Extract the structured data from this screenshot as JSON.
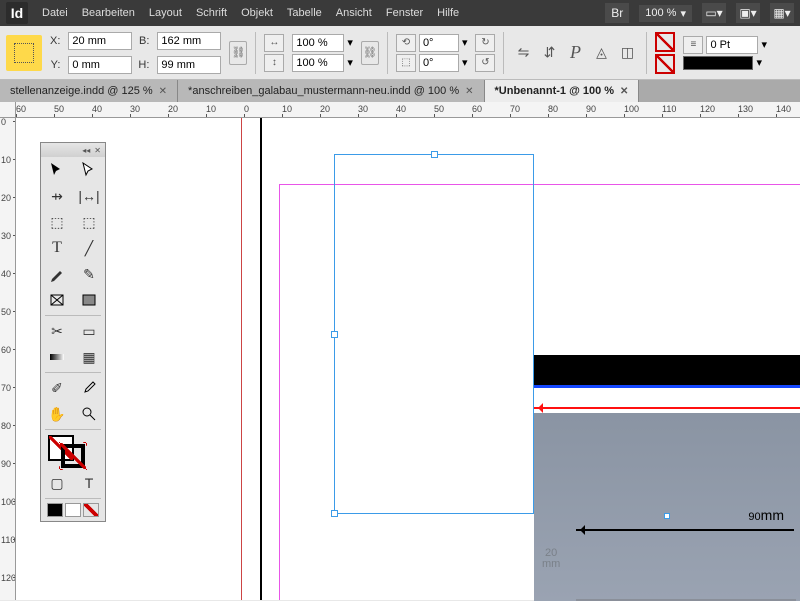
{
  "app": {
    "logo": "Id"
  },
  "menu": [
    "Datei",
    "Bearbeiten",
    "Layout",
    "Schrift",
    "Objekt",
    "Tabelle",
    "Ansicht",
    "Fenster",
    "Hilfe"
  ],
  "appbar": {
    "bridge_label": "Br",
    "zoom": "100 %"
  },
  "control": {
    "x_label": "X:",
    "x_val": "20 mm",
    "y_label": "Y:",
    "y_val": "0 mm",
    "w_label": "B:",
    "w_val": "162 mm",
    "h_label": "H:",
    "h_val": "99 mm",
    "scale_x": "100 %",
    "scale_y": "100 %",
    "rotate": "0°",
    "shear": "0°",
    "stroke_pt": "0 Pt"
  },
  "tabs": [
    {
      "label": "stellenanzeige.indd @ 125 %",
      "active": false
    },
    {
      "label": "*anschreiben_galabau_mustermann-neu.indd @ 100 %",
      "active": false
    },
    {
      "label": "*Unbenannt-1 @ 100 %",
      "active": true
    }
  ],
  "ruler_h": [
    "60",
    "50",
    "40",
    "30",
    "20",
    "10",
    "0",
    "10",
    "20",
    "30",
    "40",
    "50",
    "60",
    "70",
    "80",
    "90",
    "100",
    "110",
    "120",
    "130",
    "140"
  ],
  "ruler_v": [
    "0",
    "10",
    "20",
    "30",
    "40",
    "50",
    "60",
    "70",
    "80",
    "90",
    "100",
    "110",
    "120"
  ],
  "placed": {
    "dim_90": "90",
    "dim_90_unit": "mm",
    "dim_20": "20",
    "dim_20_unit": "mm"
  },
  "tool_names": [
    "selection",
    "direct-selection",
    "page",
    "gap",
    "content-collector",
    "content-placer",
    "type",
    "line",
    "pen",
    "pencil",
    "rectangle-frame",
    "rectangle",
    "scissors",
    "free-transform",
    "gradient-swatch",
    "gradient-feather",
    "note",
    "eyedropper",
    "hand",
    "zoom"
  ],
  "colors": {
    "selection": "#3b9be8",
    "margin": "#e855e8",
    "handle": "#fed94a"
  }
}
